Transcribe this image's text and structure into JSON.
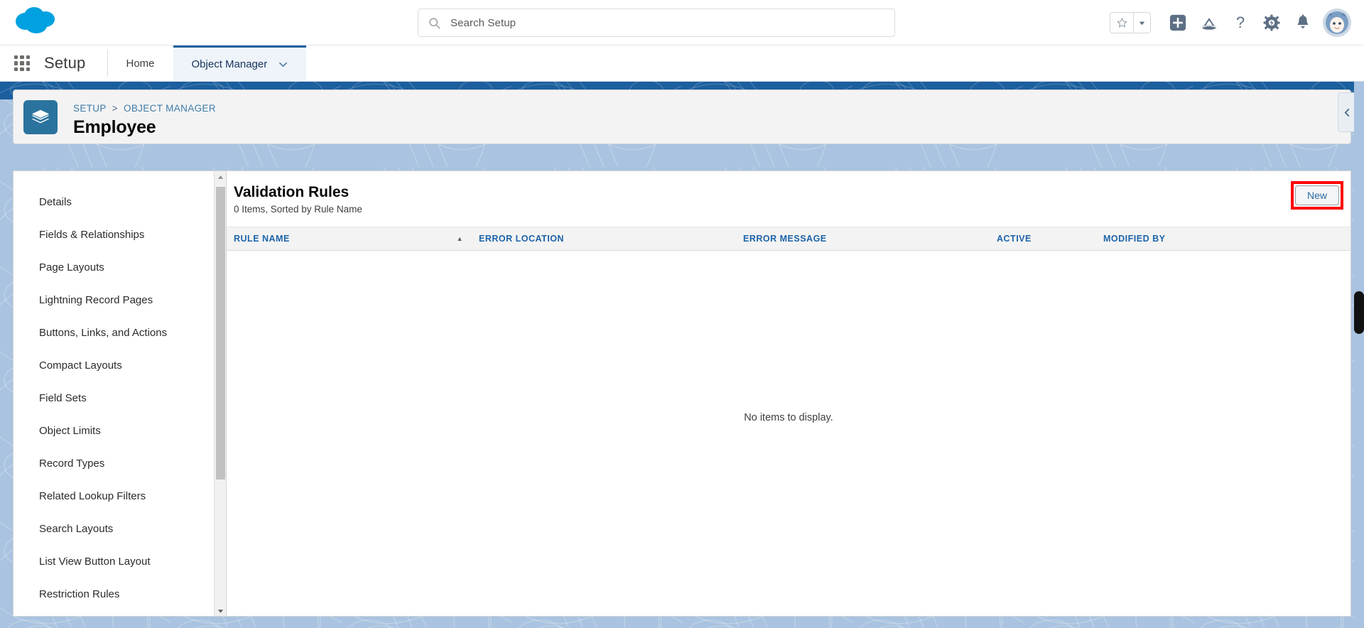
{
  "header": {
    "logo_icon": "salesforce-cloud-logo",
    "search": {
      "placeholder": "Search Setup",
      "value": "",
      "icon": "search-icon"
    },
    "icons": [
      {
        "name": "favorites-star-icon",
        "glyph": "★"
      },
      {
        "name": "favorites-dropdown-caret-icon",
        "glyph": "▾"
      },
      {
        "name": "global-actions-plus-icon",
        "glyph": "+"
      },
      {
        "name": "learning-trailhead-icon",
        "glyph": "⛰"
      },
      {
        "name": "help-question-icon",
        "glyph": "?"
      },
      {
        "name": "setup-gear-icon",
        "glyph": "⚙"
      },
      {
        "name": "notifications-bell-icon",
        "glyph": "ὑ4"
      },
      {
        "name": "user-avatar",
        "glyph": ""
      }
    ]
  },
  "setup_nav": {
    "waffle_icon": "app-launcher-waffle-icon",
    "app_name": "Setup",
    "tabs": [
      {
        "label": "Home",
        "active": false
      },
      {
        "label": "Object Manager",
        "active": true,
        "has_caret": true
      }
    ]
  },
  "page": {
    "object_icon": "object-layers-icon",
    "breadcrumb": {
      "items": [
        "SETUP",
        "OBJECT MANAGER"
      ],
      "separator": ">"
    },
    "title": "Employee",
    "panel_toggle_icon": "collapse-panel-left-icon"
  },
  "sidebar": {
    "items": [
      {
        "label": "Details"
      },
      {
        "label": "Fields & Relationships"
      },
      {
        "label": "Page Layouts"
      },
      {
        "label": "Lightning Record Pages"
      },
      {
        "label": "Buttons, Links, and Actions"
      },
      {
        "label": "Compact Layouts"
      },
      {
        "label": "Field Sets"
      },
      {
        "label": "Object Limits"
      },
      {
        "label": "Record Types"
      },
      {
        "label": "Related Lookup Filters"
      },
      {
        "label": "Search Layouts"
      },
      {
        "label": "List View Button Layout"
      },
      {
        "label": "Restriction Rules"
      }
    ],
    "scrollbar": {
      "up_arrow_icon": "scroll-up-arrow-icon",
      "down_arrow_icon": "scroll-down-arrow-icon"
    }
  },
  "main": {
    "title": "Validation Rules",
    "subtitle": "0 Items, Sorted by Rule Name",
    "new_button": {
      "label": "New",
      "highlight_color": "#ff0000"
    },
    "columns": [
      {
        "label": "RULE NAME",
        "sorted": true,
        "sort_direction": "asc",
        "sort_glyph": "▲"
      },
      {
        "label": "ERROR LOCATION",
        "sorted": false
      },
      {
        "label": "ERROR MESSAGE",
        "sorted": false
      },
      {
        "label": "ACTIVE",
        "sorted": false
      },
      {
        "label": "MODIFIED BY",
        "sorted": false
      }
    ],
    "rows": [],
    "empty_message": "No items to display."
  },
  "colors": {
    "brand_blue": "#1b5f9e",
    "link_blue": "#1c63a8",
    "backdrop_blue": "#a9c3e0",
    "object_icon_blue": "#2a739e",
    "highlight_red": "#ff0000"
  }
}
